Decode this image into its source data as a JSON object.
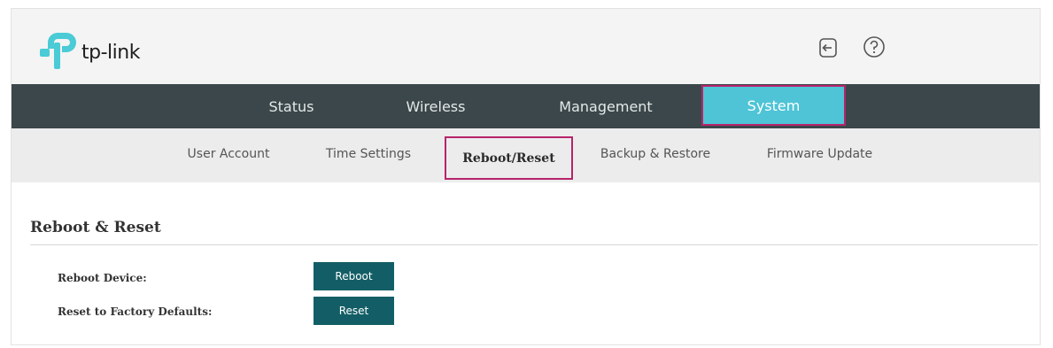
{
  "header": {
    "brand": "tp-link",
    "icons": [
      "logout-icon",
      "help-icon"
    ]
  },
  "main_nav": {
    "tabs": [
      {
        "label": "Status"
      },
      {
        "label": "Wireless"
      },
      {
        "label": "Management"
      },
      {
        "label": "System",
        "active": true
      }
    ]
  },
  "sub_nav": {
    "tabs": [
      {
        "label": "User Account"
      },
      {
        "label": "Time Settings"
      },
      {
        "label": "Reboot/Reset",
        "active": true
      },
      {
        "label": "Backup & Restore"
      },
      {
        "label": "Firmware Update"
      }
    ]
  },
  "content": {
    "section_title": "Reboot & Reset",
    "rows": [
      {
        "label": "Reboot Device:",
        "button": "Reboot"
      },
      {
        "label": "Reset to Factory Defaults:",
        "button": "Reset"
      }
    ]
  },
  "colors": {
    "nav_bg": "#3b474a",
    "active_tab": "#4ec4d6",
    "highlight_border": "#b6246a",
    "button_bg": "#135e66",
    "logo_teal": "#4acbd6"
  }
}
